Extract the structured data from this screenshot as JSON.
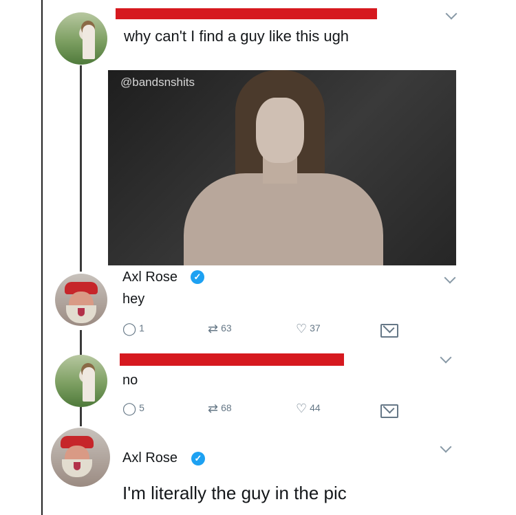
{
  "tweet1": {
    "text": "why can't I find a guy like this ugh",
    "image_watermark": "@bandsnshits"
  },
  "reply1": {
    "author": "Axl Rose",
    "verified": true,
    "text": "hey",
    "actions": {
      "replies": "1",
      "retweets": "63",
      "likes": "37"
    }
  },
  "reply2": {
    "text": "no",
    "actions": {
      "replies": "5",
      "retweets": "68",
      "likes": "44"
    }
  },
  "reply3": {
    "author": "Axl Rose",
    "verified": true,
    "text": "I'm literally the guy in the pic"
  },
  "colors": {
    "redaction": "#d6191f",
    "verified": "#1da1f2",
    "action_gray": "#657786"
  },
  "icons": [
    "reply-icon",
    "retweet-icon",
    "heart-icon",
    "mail-icon",
    "chevron-down-icon",
    "verified-badge-icon"
  ]
}
